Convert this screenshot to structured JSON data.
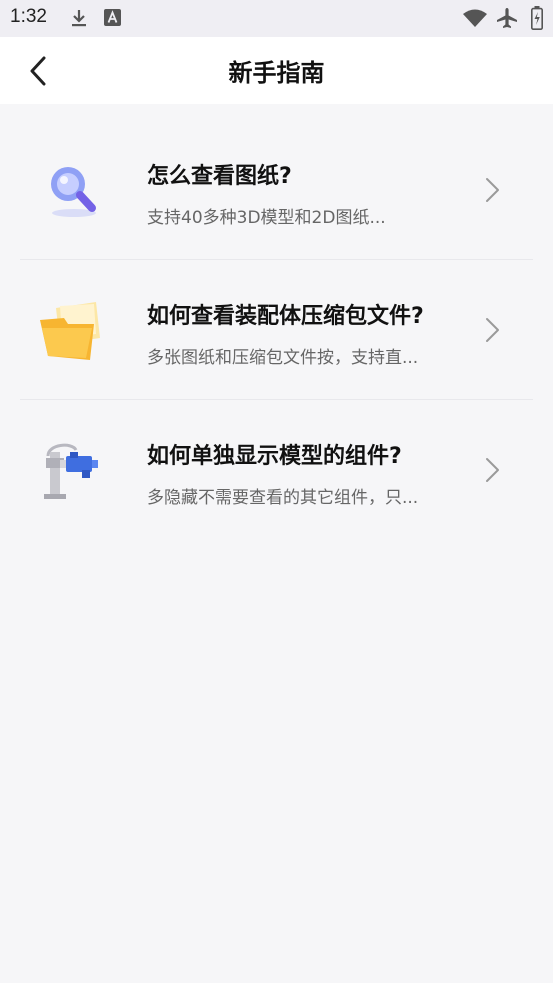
{
  "status_bar": {
    "time": "1:32",
    "icons": [
      "download-icon",
      "text-a-icon",
      "wifi-icon",
      "airplane-icon",
      "battery-icon"
    ]
  },
  "header": {
    "title": "新手指南",
    "back_icon": "chevron-left-icon"
  },
  "guides": [
    {
      "title": "怎么查看图纸?",
      "subtitle": "支持40多种3D模型和2D图纸...",
      "icon": "magnifier-icon"
    },
    {
      "title": "如何查看装配体压缩包文件?",
      "subtitle": "多张图纸和压缩包文件按，支持直...",
      "icon": "folder-icon"
    },
    {
      "title": "如何单独显示模型的组件?",
      "subtitle": "多隐藏不需要查看的其它组件，只...",
      "icon": "model-component-icon"
    }
  ],
  "colors": {
    "background": "#f6f6f8",
    "header": "#ffffff",
    "status_bar": "#efeef3",
    "title_text": "#111111",
    "subtitle_text": "#666666",
    "chevron": "#9a9a9a"
  }
}
